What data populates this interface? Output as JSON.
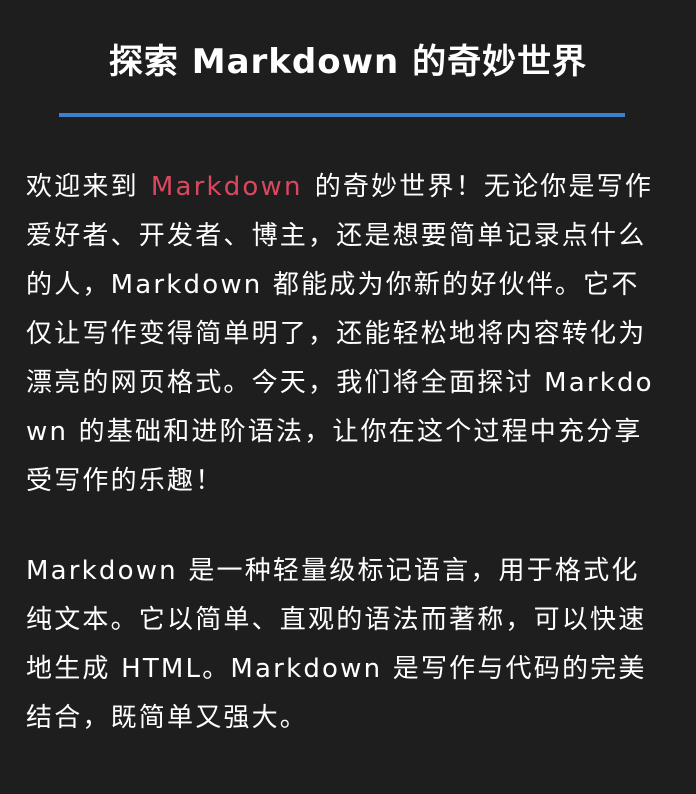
{
  "article": {
    "title": "探索 Markdown 的奇妙世界",
    "paragraph1": {
      "before": "欢迎来到",
      "code": "Markdown",
      "after": "的奇妙世界！无论你是写作爱好者、开发者、博主，还是想要简单记录点什么的人，Markdown 都能成为你新的好伙伴。它不仅让写作变得简单明了，还能轻松地将内容转化为漂亮的网页格式。今天，我们将全面探讨 Markdown 的基础和进阶语法，让你在这个过程中充分享受写作的乐趣！"
    },
    "paragraph2": "Markdown 是一种轻量级标记语言，用于格式化纯文本。它以简单、直观的语法而著称，可以快速地生成 HTML。Markdown 是写作与代码的完美结合，既简单又强大。"
  },
  "colors": {
    "background": "#1e1e1e",
    "text": "#ffffff",
    "rule": "#3f7fd0",
    "inline_code": "#d9485f"
  }
}
